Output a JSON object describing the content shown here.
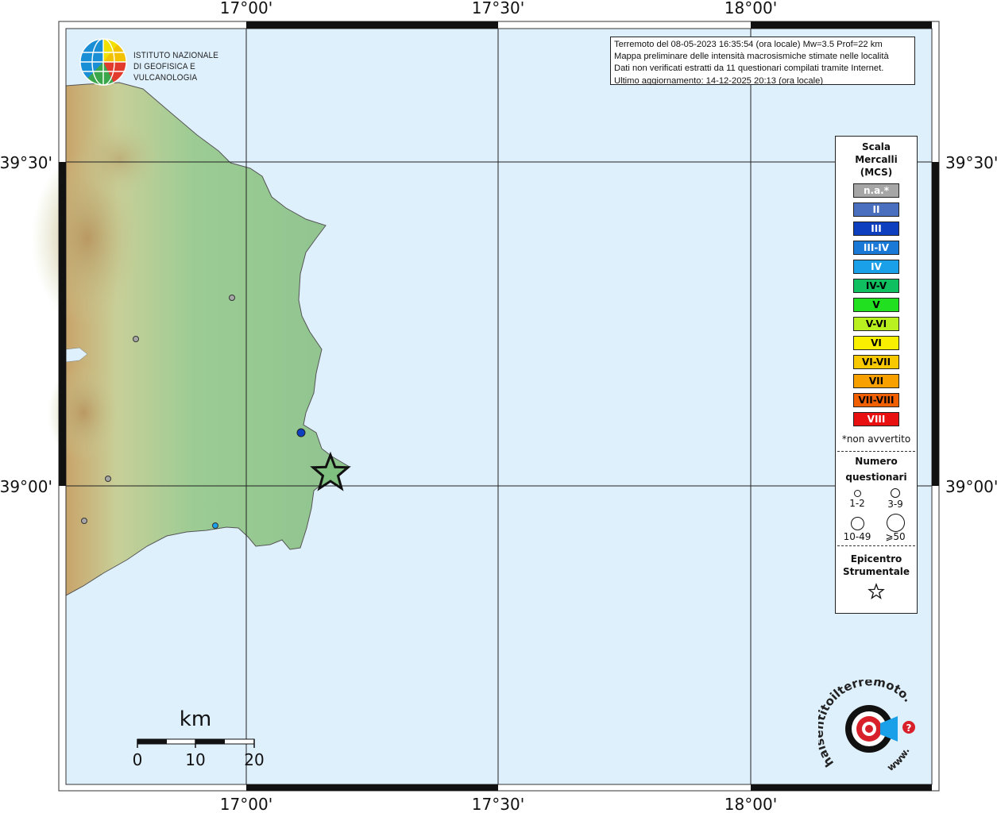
{
  "map": {
    "lon_labels": [
      "17°00'",
      "17°30'",
      "18°00'"
    ],
    "lat_labels": [
      "39°30'",
      "39°00'"
    ]
  },
  "info": {
    "line1": "Terremoto del 08-05-2023 16:35:54 (ora locale) Mw=3.5 Prof=22 km",
    "line2": "Mappa preliminare delle intensità macrosismiche stimate nelle località",
    "line3": "Dati non verificati estratti da 11 questionari compilati tramite Internet.",
    "line4": "Ultimo aggiornamento: 14-12-2025 20:13 (ora locale)"
  },
  "logo": {
    "org_line1": "ISTITUTO NAZIONALE",
    "org_line2": "DI GEOFISICA E VULCANOLOGIA",
    "site_text": "haisentitoilterremoto.it",
    "site_prefix": "www."
  },
  "legend": {
    "title_line1": "Scala",
    "title_line2": "Mercalli",
    "title_line3": "(MCS)",
    "items": [
      {
        "label": "n.a.*",
        "color": "#a6a6a6",
        "text_color": "#ffffff"
      },
      {
        "label": "II",
        "color": "#4a6fbf",
        "text_color": "#ffffff"
      },
      {
        "label": "III",
        "color": "#0d3fbf",
        "text_color": "#ffffff"
      },
      {
        "label": "III-IV",
        "color": "#1a78d6",
        "text_color": "#ffffff"
      },
      {
        "label": "IV",
        "color": "#1aa0e8",
        "text_color": "#ffffff"
      },
      {
        "label": "IV-V",
        "color": "#10c060",
        "text_color": "#000000"
      },
      {
        "label": "V",
        "color": "#20e020",
        "text_color": "#000000"
      },
      {
        "label": "V-VI",
        "color": "#b8f020",
        "text_color": "#000000"
      },
      {
        "label": "VI",
        "color": "#f8f000",
        "text_color": "#000000"
      },
      {
        "label": "VI-VII",
        "color": "#f8c800",
        "text_color": "#000000"
      },
      {
        "label": "VII",
        "color": "#f8a000",
        "text_color": "#000000"
      },
      {
        "label": "VII-VIII",
        "color": "#f06000",
        "text_color": "#000000"
      },
      {
        "label": "VIII",
        "color": "#e81010",
        "text_color": "#ffffff"
      }
    ],
    "note": "*non avvertito",
    "count_title_line1": "Numero",
    "count_title_line2": "questionari",
    "count_classes": [
      "1-2",
      "3-9",
      "10-49",
      "⩾50"
    ],
    "epicenter_line1": "Epicentro",
    "epicenter_line2": "Strumentale"
  },
  "scalebar": {
    "unit": "km",
    "ticks": [
      "0",
      "10",
      "20"
    ]
  },
  "markers": [
    {
      "name": "locality-marker",
      "intensity": "n.a.*",
      "color": "#a6a6a6"
    },
    {
      "name": "locality-marker",
      "intensity": "n.a.*",
      "color": "#a6a6a6"
    },
    {
      "name": "locality-marker",
      "intensity": "n.a.*",
      "color": "#a6a6a6"
    },
    {
      "name": "locality-marker",
      "intensity": "n.a.*",
      "color": "#a6a6a6"
    },
    {
      "name": "locality-marker",
      "intensity": "III",
      "color": "#0d3fbf"
    },
    {
      "name": "locality-marker",
      "intensity": "IV",
      "color": "#1aa0e8"
    }
  ],
  "colors": {
    "sea": "#dff0fd",
    "land_low": "#8fc38f",
    "land_mid": "#c8cf98",
    "land_high": "#c9a46a",
    "epicenter": "#7fbf7f"
  }
}
